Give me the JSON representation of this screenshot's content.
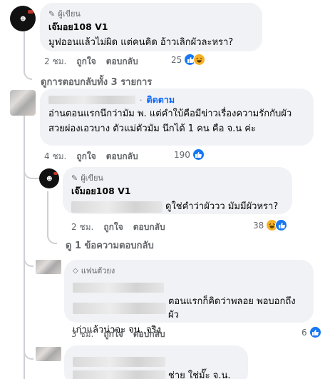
{
  "comment1": {
    "badge": "ผู้เขียน",
    "author": "เจ๊มอย108 V1",
    "text": "มูฟออนแล้วไม่ผิด แต่คนคิด อ้าวเลิกผัวละหรา?",
    "time": "2 ชม.",
    "like_label": "ถูกใจ",
    "reply_label": "ตอบกลับ",
    "reaction_count": "25",
    "reactions": [
      "like-icon",
      "haha-icon"
    ]
  },
  "view_all_replies": "ดูการตอบกลับทั้ง 3 รายการ",
  "comment2": {
    "badge": "ติดตาม",
    "text_line1": "อ่านตอนแรกนึกว่ามัม พ. แต่คำใบ้คือมีข่าวเรื่องความรักกับผัว",
    "text_line2": "สวยผ่องเอวบาง ตัวแม่ตัวมัม นึกได้ 1 คน คือ จ.น ค่ะ",
    "time": "4 ชม.",
    "like_label": "ถูกใจ",
    "reply_label": "ตอบกลับ",
    "reaction_count": "190",
    "reactions": [
      "like-icon"
    ]
  },
  "reply1": {
    "badge": "ผู้เขียน",
    "author": "เจ๊มอย108 V1",
    "text": "ดูใช่คำว่าผัววว มัมมีผัวหรา?",
    "time": "2 ชม.",
    "like_label": "ถูกใจ",
    "reply_label": "ตอบกลับ",
    "reaction_count": "38",
    "reactions": [
      "haha-icon",
      "like-icon"
    ]
  },
  "view_one_reply": "ดู 1 ข้อความตอบกลับ",
  "comment3": {
    "badge": "แฟนตัวยง",
    "text_line1": "ตอนแรกก็คิดว่าพลอย พอบอกถึงผัว",
    "text_line2": "เก่าแล้วน่าจะ จน. จริง",
    "time": "3 ชม.",
    "like_label": "ถูกใจ",
    "reply_label": "ตอบกลับ",
    "reaction_count": "6",
    "reactions": [
      "like-icon"
    ]
  },
  "comment4": {
    "text": "ช่าย ใช่มั๊ะ จ.น."
  },
  "colors": {
    "bubble": "#f0f2f5",
    "link_blue": "#0866ff",
    "meta_gray": "#65676b",
    "like_blue": "#1877f2",
    "haha_yellow": "#f7b125"
  }
}
